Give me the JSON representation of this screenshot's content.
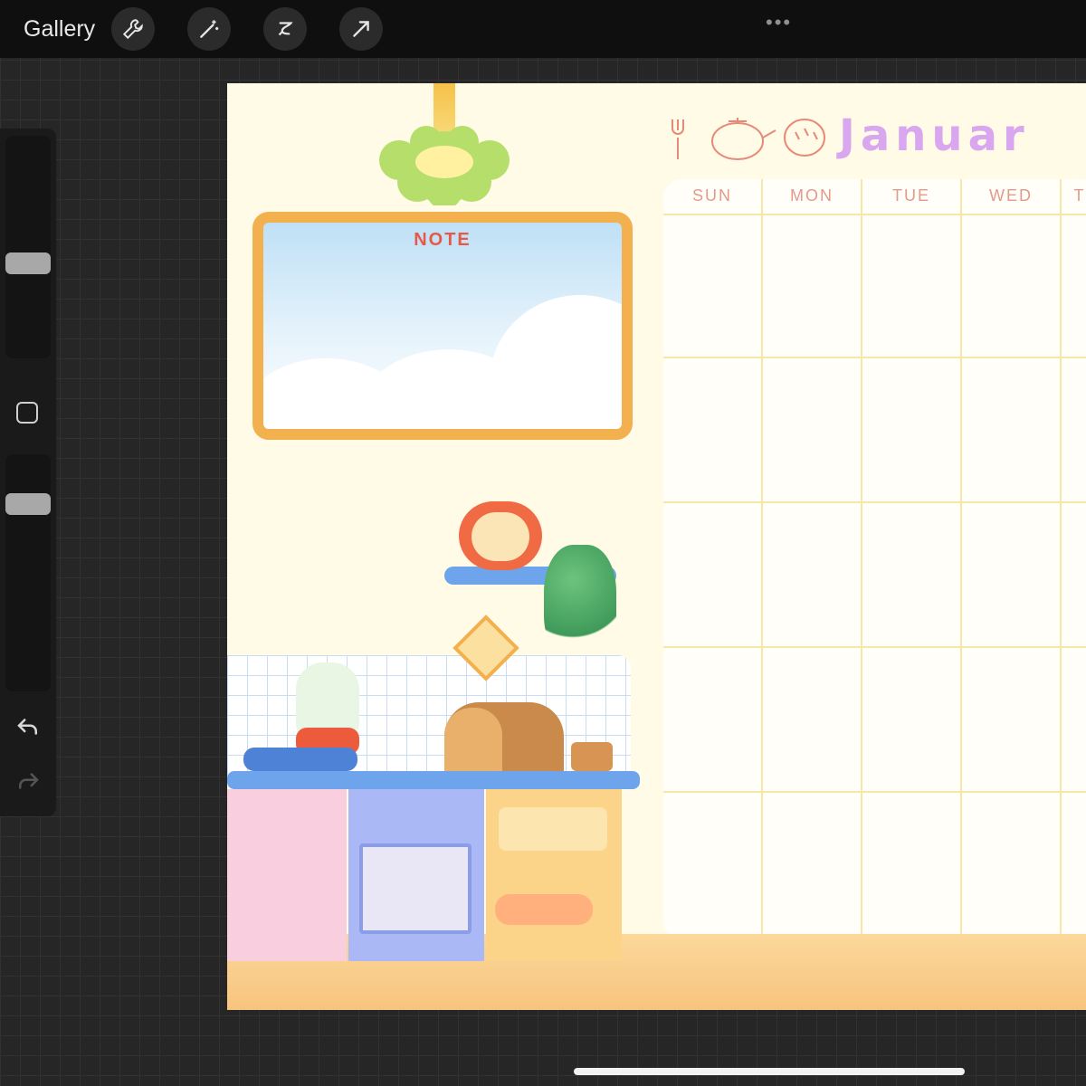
{
  "toolbar": {
    "gallery_label": "Gallery",
    "tools": [
      "wrench-icon",
      "magic-wand-icon",
      "selection-icon",
      "transform-arrow-icon"
    ],
    "more_label": "•••"
  },
  "sidebar": {
    "brush_size_level": 0.42,
    "opacity_level": 0.82,
    "undo_icon": "undo-icon",
    "redo_icon": "redo-icon"
  },
  "artwork": {
    "note_title": "NOTE",
    "calendar_title": "Januar",
    "weekdays": [
      "SUN",
      "MON",
      "TUE",
      "WED",
      "T"
    ]
  },
  "colors": {
    "canvas_bg": "#fffbe6",
    "accent_pink": "#e8584a",
    "calendar_title": "#d9a6f0"
  }
}
